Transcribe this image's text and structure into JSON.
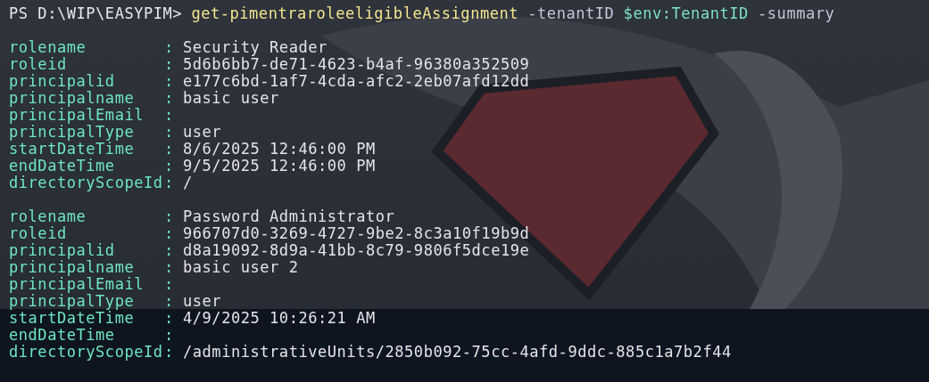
{
  "prompt": {
    "text": "PS D:\\WIP\\EASYPIM>",
    "tokens": [
      {
        "kind": "command",
        "text": "get-pimentraroleeligibleAssignment"
      },
      {
        "kind": "parameter",
        "text": "-tenantID"
      },
      {
        "kind": "variable",
        "text": "$env:TenantID"
      },
      {
        "kind": "parameter",
        "text": "-summary"
      }
    ]
  },
  "records": [
    {
      "fields": [
        {
          "name": "rolename",
          "separator": ":",
          "value": "Security Reader"
        },
        {
          "name": "roleid",
          "separator": ":",
          "value": "5d6b6bb7-de71-4623-b4af-96380a352509"
        },
        {
          "name": "principalid",
          "separator": ":",
          "value": "e177c6bd-1af7-4cda-afc2-2eb07afd12dd"
        },
        {
          "name": "principalname",
          "separator": ":",
          "value": "basic user"
        },
        {
          "name": "principalEmail",
          "separator": ":"
        },
        {
          "name": "principalType",
          "separator": ":",
          "value": "user"
        },
        {
          "name": "startDateTime",
          "separator": ":",
          "value": "8/6/2025 12:46:00 PM"
        },
        {
          "name": "endDateTime",
          "separator": ":",
          "value": "9/5/2025 12:46:00 PM"
        },
        {
          "name": "directoryScopeId",
          "separator": ":",
          "value": "/"
        }
      ]
    },
    {
      "fields": [
        {
          "name": "rolename",
          "separator": ":",
          "value": "Password Administrator"
        },
        {
          "name": "roleid",
          "separator": ":",
          "value": "966707d0-3269-4727-9be2-8c3a10f19b9d"
        },
        {
          "name": "principalid",
          "separator": ":",
          "value": "d8a19092-8d9a-41bb-8c79-9806f5dce19e"
        },
        {
          "name": "principalname",
          "separator": ":",
          "value": "basic user 2"
        },
        {
          "name": "principalEmail",
          "separator": ":"
        },
        {
          "name": "principalType",
          "separator": ":",
          "value": "user"
        },
        {
          "name": "startDateTime",
          "separator": ":",
          "value": "4/9/2025 10:26:21 AM"
        },
        {
          "name": "endDateTime",
          "separator": ":"
        },
        {
          "name": "directoryScopeId",
          "separator": ":",
          "value": "/administrativeUnits/2850b092-75cc-4afd-9ddc-885c1a7b2f44"
        }
      ]
    }
  ]
}
